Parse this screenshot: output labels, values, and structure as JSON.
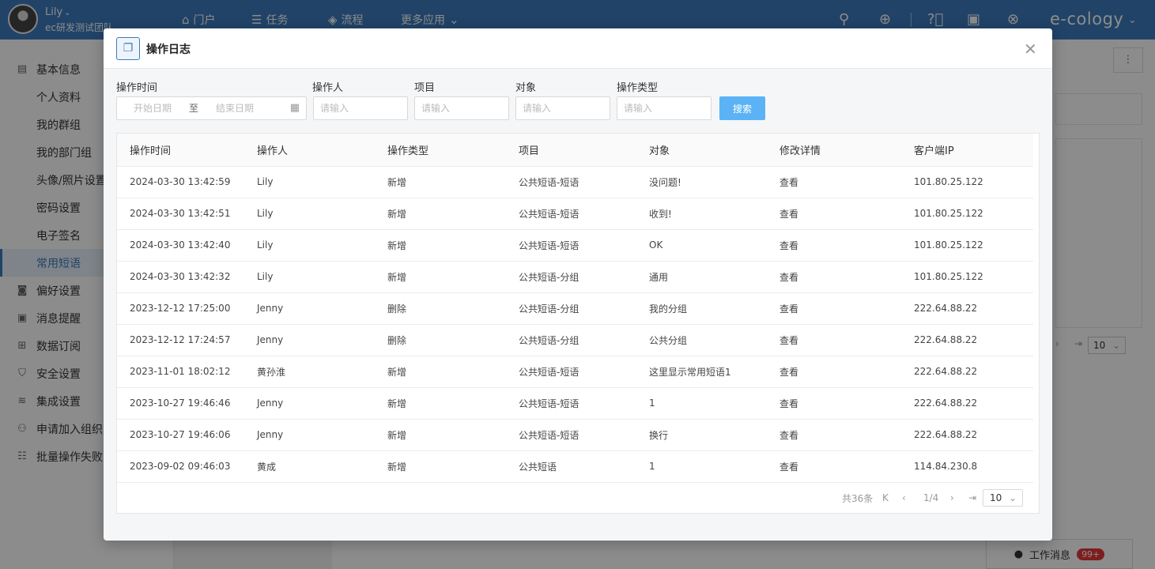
{
  "topbar": {
    "user_name": "Lily",
    "user_org": "ec研发测试团队",
    "nav": [
      {
        "icon": "home-icon",
        "glyph": "⌂",
        "label": "门户"
      },
      {
        "icon": "list-icon",
        "glyph": "☰",
        "label": "任务"
      },
      {
        "icon": "layers-icon",
        "glyph": "◈",
        "label": "流程"
      },
      {
        "icon": "chevron-down-icon",
        "glyph": "⌄",
        "label": "更多应用"
      }
    ],
    "brand": "e-cology"
  },
  "sidebar": {
    "items": [
      {
        "icon": "file-icon",
        "glyph": "▤",
        "label": "基本信息",
        "sub": false,
        "active": false
      },
      {
        "label": "个人资料",
        "sub": true,
        "active": false
      },
      {
        "label": "我的群组",
        "sub": true,
        "active": false
      },
      {
        "label": "我的部门组",
        "sub": true,
        "active": false
      },
      {
        "label": "头像/照片设置",
        "sub": true,
        "active": false
      },
      {
        "label": "密码设置",
        "sub": true,
        "active": false
      },
      {
        "label": "电子签名",
        "sub": true,
        "active": false
      },
      {
        "label": "常用短语",
        "sub": true,
        "active": true
      },
      {
        "icon": "camera-icon",
        "glyph": "◙",
        "label": "偏好设置",
        "sub": false,
        "active": false
      },
      {
        "icon": "message-icon",
        "glyph": "▣",
        "label": "消息提醒",
        "sub": false,
        "active": false
      },
      {
        "icon": "subscription-icon",
        "glyph": "⊞",
        "label": "数据订阅",
        "sub": false,
        "active": false
      },
      {
        "icon": "shield-icon",
        "glyph": "⛉",
        "label": "安全设置",
        "sub": false,
        "active": false
      },
      {
        "icon": "stack-icon",
        "glyph": "≋",
        "label": "集成设置",
        "sub": false,
        "active": false
      },
      {
        "icon": "user-add-icon",
        "glyph": "⚇",
        "label": "申请加入组织",
        "sub": false,
        "active": false
      },
      {
        "icon": "batch-list-icon",
        "glyph": "☷",
        "label": "批量操作失败",
        "sub": false,
        "active": false
      }
    ]
  },
  "background": {
    "page_size": "10",
    "work_messages_label": "工作消息",
    "work_messages_badge": "99+"
  },
  "modal": {
    "title": "操作日志",
    "filters": {
      "time_label": "操作时间",
      "start_placeholder": "开始日期",
      "to_label": "至",
      "end_placeholder": "结束日期",
      "operator_label": "操作人",
      "operator_placeholder": "请输入",
      "item_label": "项目",
      "item_placeholder": "请输入",
      "object_label": "对象",
      "object_placeholder": "请输入",
      "type_label": "操作类型",
      "type_placeholder": "请输入",
      "search_label": "搜索"
    },
    "table": {
      "headers": [
        "操作时间",
        "操作人",
        "操作类型",
        "项目",
        "对象",
        "修改详情",
        "客户端IP"
      ],
      "rows": [
        [
          "2024-03-30 13:42:59",
          "Lily",
          "新增",
          "公共短语-短语",
          "没问题!",
          "查看",
          "101.80.25.122"
        ],
        [
          "2024-03-30 13:42:51",
          "Lily",
          "新增",
          "公共短语-短语",
          "收到!",
          "查看",
          "101.80.25.122"
        ],
        [
          "2024-03-30 13:42:40",
          "Lily",
          "新增",
          "公共短语-短语",
          "OK",
          "查看",
          "101.80.25.122"
        ],
        [
          "2024-03-30 13:42:32",
          "Lily",
          "新增",
          "公共短语-分组",
          "通用",
          "查看",
          "101.80.25.122"
        ],
        [
          "2023-12-12 17:25:00",
          "Jenny",
          "删除",
          "公共短语-分组",
          "我的分组",
          "查看",
          "222.64.88.22"
        ],
        [
          "2023-12-12 17:24:57",
          "Jenny",
          "删除",
          "公共短语-分组",
          "公共分组",
          "查看",
          "222.64.88.22"
        ],
        [
          "2023-11-01 18:02:12",
          "黄孙淮",
          "新增",
          "公共短语-短语",
          "这里显示常用短语1",
          "查看",
          "222.64.88.22"
        ],
        [
          "2023-10-27 19:46:46",
          "Jenny",
          "新增",
          "公共短语-短语",
          "1",
          "查看",
          "222.64.88.22"
        ],
        [
          "2023-10-27 19:46:06",
          "Jenny",
          "新增",
          "公共短语-短语",
          "换行",
          "查看",
          "222.64.88.22"
        ],
        [
          "2023-09-02 09:46:03",
          "黄成",
          "新增",
          "公共短语",
          "1",
          "查看",
          "114.84.230.8"
        ]
      ]
    },
    "pagination": {
      "total": "共36条",
      "page": "1/4",
      "page_size": "10"
    }
  }
}
